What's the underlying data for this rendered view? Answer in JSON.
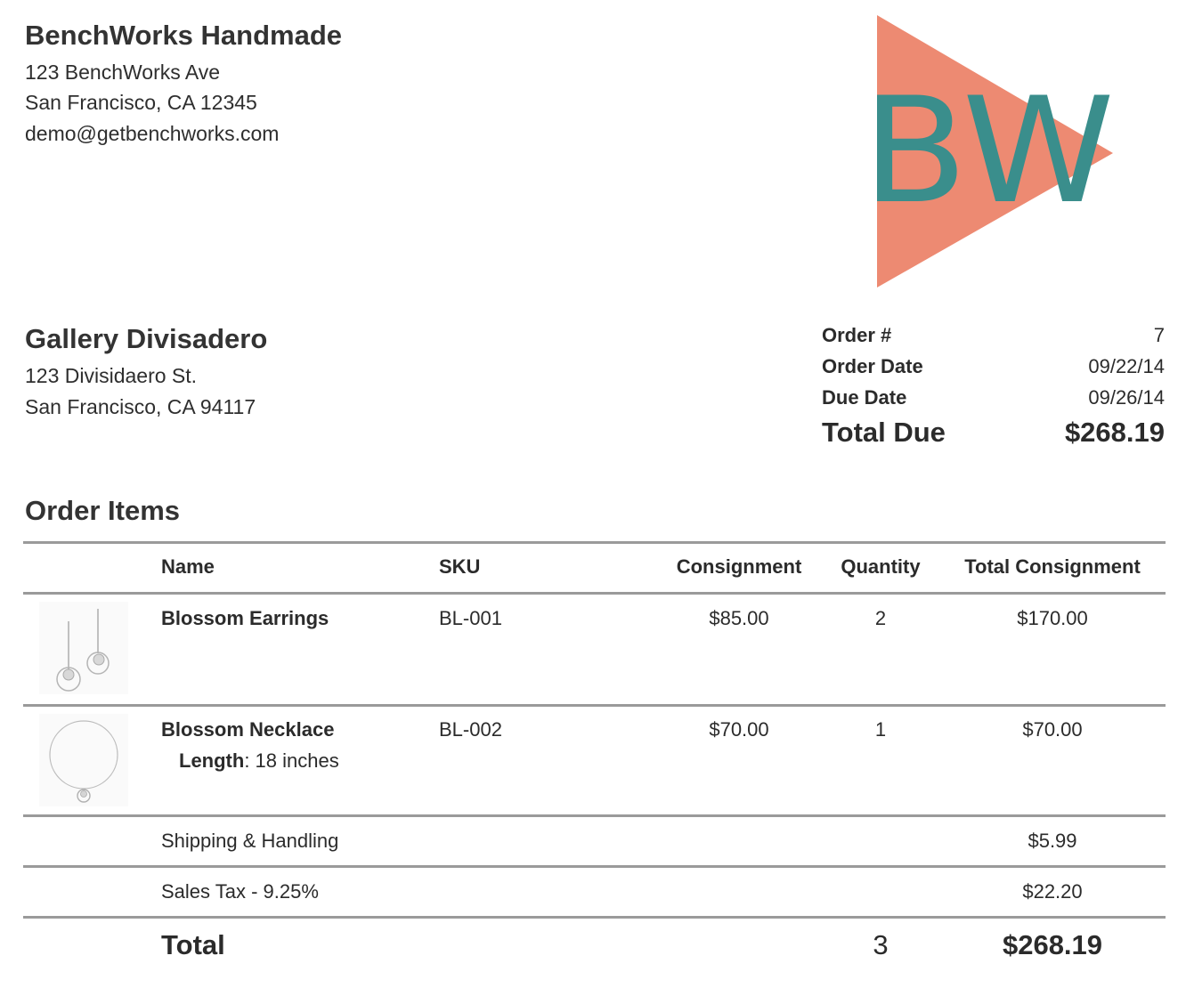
{
  "seller": {
    "name": "BenchWorks Handmade",
    "address_line1": "123 BenchWorks Ave",
    "address_line2": "San Francisco, CA 12345",
    "email": "demo@getbenchworks.com"
  },
  "logo": {
    "text": "BW",
    "triangle_color": "#ED8A72",
    "text_color": "#3A8E8C"
  },
  "client": {
    "name": "Gallery Divisadero",
    "address_line1": "123 Divisidaero St.",
    "address_line2": "San Francisco, CA 94117"
  },
  "order": {
    "number_label": "Order #",
    "number_value": "7",
    "date_label": "Order Date",
    "date_value": "09/22/14",
    "due_label": "Due Date",
    "due_value": "09/26/14",
    "total_due_label": "Total Due",
    "total_due_value": "$268.19"
  },
  "items_section": {
    "title": "Order Items",
    "headers": {
      "name": "Name",
      "sku": "SKU",
      "consignment": "Consignment",
      "quantity": "Quantity",
      "total_consignment": "Total Consignment"
    },
    "rows": [
      {
        "name": "Blossom Earrings",
        "sku": "BL-001",
        "consignment": "$85.00",
        "quantity": "2",
        "total": "$170.00",
        "thumbnail_icon": "earrings-icon"
      },
      {
        "name": "Blossom Necklace",
        "option_label": "Length",
        "option_value": ": 18 inches",
        "sku": "BL-002",
        "consignment": "$70.00",
        "quantity": "1",
        "total": "$70.00",
        "thumbnail_icon": "necklace-icon"
      }
    ],
    "shipping_label": "Shipping & Handling",
    "shipping_value": "$5.99",
    "tax_label": "Sales Tax - 9.25%",
    "tax_value": "$22.20",
    "total_label": "Total",
    "total_quantity": "3",
    "total_value": "$268.19"
  }
}
